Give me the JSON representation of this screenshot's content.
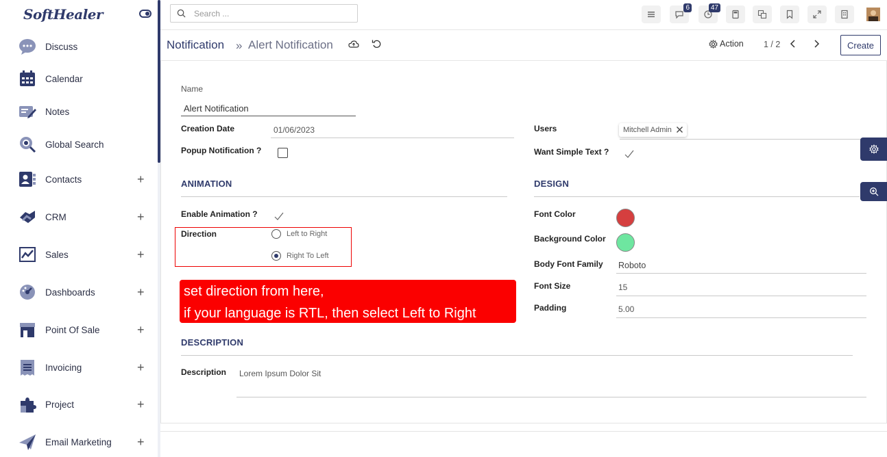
{
  "brand": {
    "logo_text": "SoftHealer",
    "accent": "#2f3a6b"
  },
  "sidebar": {
    "items": [
      {
        "label": "Discuss",
        "icon": "discuss-icon",
        "expandable": false
      },
      {
        "label": "Calendar",
        "icon": "calendar-icon",
        "expandable": false
      },
      {
        "label": "Notes",
        "icon": "notes-icon",
        "expandable": false
      },
      {
        "label": "Global Search",
        "icon": "global-search-icon",
        "expandable": false
      },
      {
        "label": "Contacts",
        "icon": "contacts-icon",
        "expandable": true
      },
      {
        "label": "CRM",
        "icon": "crm-icon",
        "expandable": true
      },
      {
        "label": "Sales",
        "icon": "sales-icon",
        "expandable": true
      },
      {
        "label": "Dashboards",
        "icon": "dashboards-icon",
        "expandable": true
      },
      {
        "label": "Point Of Sale",
        "icon": "point-of-sale-icon",
        "expandable": true
      },
      {
        "label": "Invoicing",
        "icon": "invoicing-icon",
        "expandable": true
      },
      {
        "label": "Project",
        "icon": "project-icon",
        "expandable": true
      },
      {
        "label": "Email Marketing",
        "icon": "email-marketing-icon",
        "expandable": true
      }
    ],
    "plus": "+"
  },
  "topbar": {
    "search_placeholder": "Search ...",
    "messages_badge": "6",
    "activities_badge": "47"
  },
  "control": {
    "breadcrumb_root": "Notification",
    "breadcrumb_sep": "»",
    "breadcrumb_current": "Alert Notification",
    "action_label": "Action",
    "pager": "1 / 2",
    "create_label": "Create"
  },
  "form": {
    "name_label": "Name",
    "name_value": "Alert Notification",
    "creation_date_label": "Creation Date",
    "creation_date_value": "01/06/2023",
    "popup_label": "Popup Notification ?",
    "popup_checked": false,
    "users_label": "Users",
    "users_tag": "Mitchell Admin",
    "simple_text_label": "Want Simple Text ?",
    "simple_text_checked": true,
    "animation_section": "ANIMATION",
    "enable_animation_label": "Enable Animation ?",
    "enable_animation_checked": true,
    "direction_label": "Direction",
    "direction_options": [
      "Left to Right",
      "Right To Left"
    ],
    "direction_selected": "Right To Left",
    "design_section": "DESIGN",
    "font_color_label": "Font Color",
    "font_color": "#d53f3f",
    "bg_color_label": "Background Color",
    "bg_color": "#6ee6a0",
    "body_font_family_label": "Body Font Family",
    "body_font_family_value": "Roboto",
    "font_size_label": "Font Size",
    "font_size_value": "15",
    "padding_label": "Padding",
    "padding_value": "5.00",
    "description_section": "DESCRIPTION",
    "description_label": "Description",
    "description_value": "Lorem Ipsum Dolor Sit"
  },
  "callout": {
    "line1": "set direction from here,",
    "line2": "if your language is RTL, then select Left to Right",
    "color": "#fb0000"
  }
}
